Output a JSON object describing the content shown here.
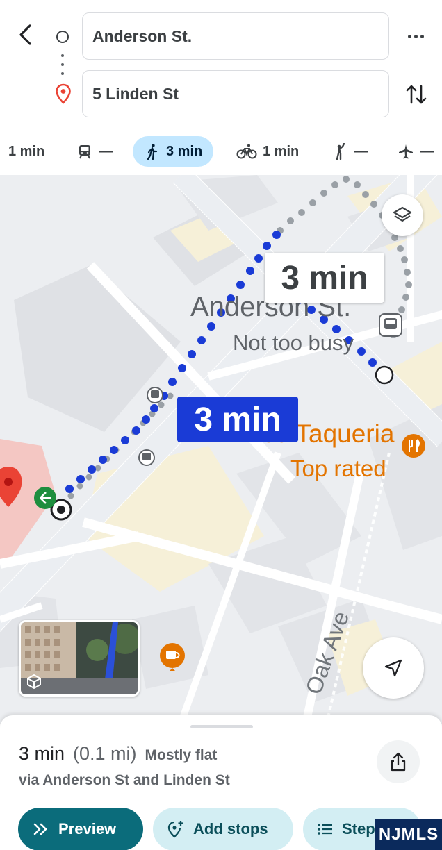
{
  "header": {
    "origin": "Anderson St.",
    "destination": "5 Linden St",
    "icons": {
      "back": "back-arrow-icon",
      "origin": "origin-circle-icon",
      "destination": "destination-pin-icon",
      "more": "more-options-icon",
      "swap": "swap-icon"
    }
  },
  "modes": {
    "drive": {
      "value": "1 min",
      "icon": "car-icon"
    },
    "transit": {
      "value": "—",
      "icon": "transit-icon"
    },
    "walk": {
      "value": "3 min",
      "icon": "walk-icon",
      "selected": true
    },
    "bike": {
      "value": "1 min",
      "icon": "bike-icon"
    },
    "rideshare": {
      "value": "—",
      "icon": "rideshare-icon"
    },
    "flight": {
      "value": "—",
      "icon": "airplane-icon"
    }
  },
  "map": {
    "route_label": "3 min",
    "alt_route_label": "3 min",
    "place_name": "Anderson St.",
    "place_status": "Not too busy",
    "restaurant_name": "Prince Taqueria",
    "restaurant_badge": "Top rated",
    "street_name": "Oak Ave",
    "colors": {
      "route": "#1a3bd6",
      "alt_route": "#9aa0a6",
      "restaurant": "#e37400",
      "destination_pin": "#ea4335"
    }
  },
  "sheet": {
    "time": "3 min",
    "distance": "(0.1 mi)",
    "elevation": "Mostly flat",
    "via": "via Anderson St and Linden St",
    "buttons": {
      "preview": "Preview",
      "add_stops": "Add stops",
      "steps": "Steps"
    },
    "colors": {
      "preview_bg": "#0b6c7b",
      "secondary_bg": "#d3eef3"
    }
  },
  "watermark": "NJMLS"
}
